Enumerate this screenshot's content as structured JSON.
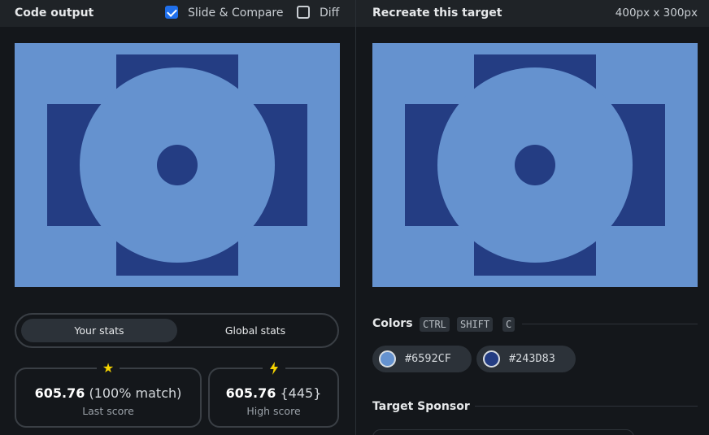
{
  "left_panel": {
    "title": "Code output",
    "slide_compare": {
      "label": "Slide & Compare",
      "checked": true
    },
    "diff": {
      "label": "Diff",
      "checked": false
    },
    "stats_tabs": {
      "your": "Your stats",
      "global": "Global stats",
      "active": "your"
    },
    "last_score": {
      "score": "605.76",
      "detail": "(100% match)",
      "label": "Last score",
      "icon": "star-icon"
    },
    "high_score": {
      "score": "605.76",
      "detail": "{445}",
      "label": "High score",
      "icon": "bolt-icon"
    }
  },
  "right_panel": {
    "title": "Recreate this target",
    "dimensions": "400px x 300px",
    "colors_heading": "Colors",
    "shortcut_keys": [
      "CTRL",
      "SHIFT",
      "C"
    ],
    "colors": [
      {
        "hex": "#6592CF",
        "label": "#6592CF"
      },
      {
        "hex": "#243D83",
        "label": "#243D83"
      }
    ],
    "sponsor_heading": "Target Sponsor"
  },
  "target_image": {
    "background": "#6592CF",
    "accent": "#243D83"
  },
  "theme": {
    "checkbox_accent": "#1f6feb",
    "star_color": "#f5d300"
  }
}
